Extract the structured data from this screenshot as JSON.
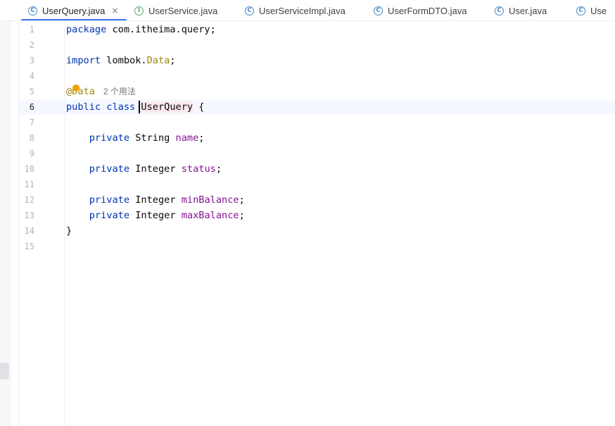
{
  "tabs": [
    {
      "label": "UserQuery.java",
      "icon": "C",
      "active": true,
      "closable": true
    },
    {
      "label": "UserService.java",
      "icon": "I"
    },
    {
      "label": "UserServiceImpl.java",
      "icon": "C"
    },
    {
      "label": "UserFormDTO.java",
      "icon": "C"
    },
    {
      "label": "User.java",
      "icon": "C"
    },
    {
      "label": "Use",
      "icon": "C"
    }
  ],
  "tab_close_glyph": "×",
  "editor": {
    "line_numbers": [
      "1",
      "2",
      "3",
      "4",
      "5",
      "6",
      "7",
      "8",
      "9",
      "10",
      "11",
      "12",
      "13",
      "14",
      "15"
    ],
    "current_line": "6",
    "usage_hint": "2 个用法",
    "code": {
      "l1_kw": "package",
      "l1_rest": " com.itheima.query;",
      "l3_kw": "import",
      "l3_pkg": " lombok.",
      "l3_type": "Data",
      "l3_end": ";",
      "l5_ann": "@Data",
      "l6_kw": "public class ",
      "l6_cls": "UserQuery",
      "l6_end": " {",
      "l8_kw": "private",
      "l8_type": " String ",
      "l8_field": "name",
      "l10_kw": "private",
      "l10_type": " Integer ",
      "l10_field": "status",
      "l12_kw": "private",
      "l12_type": " Integer ",
      "l12_field": "minBalance",
      "l13_kw": "private",
      "l13_type": " Integer ",
      "l13_field": "maxBalance",
      "semicolon": ";",
      "l14_brace": "}"
    }
  },
  "colors": {
    "keyword": "#0033b3",
    "annotation": "#9e880d",
    "field": "#871094",
    "tab_underline": "#3574f0",
    "class_icon": "#4a88c7",
    "interface_icon": "#59a869"
  }
}
